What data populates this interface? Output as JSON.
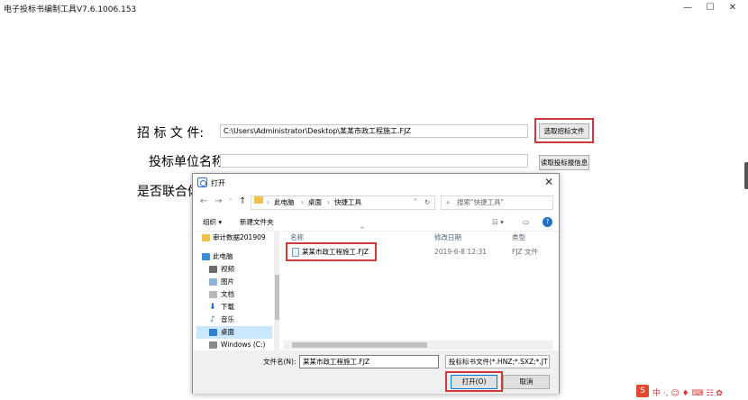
{
  "app": {
    "title": "电子投标书编制工具V7.6.1006.153",
    "minimize": "—",
    "maximize": "☐",
    "close": "✕"
  },
  "form": {
    "bid_file_label": "招  标  文  件:",
    "bid_file_value": "C:\\Users\\Administrator\\Desktop\\某某市政工程施工.FJZ",
    "select_bid_file_button": "选取招标文件",
    "bidder_name_label": "投标单位名称:",
    "bidder_name_value": "",
    "read_bidder_info_button": "读取投标报信息",
    "joint_label": "是否联合体"
  },
  "dialog": {
    "title": "打开",
    "close": "✕",
    "breadcrumb": [
      "此电脑",
      "桌面",
      "快捷工具"
    ],
    "search_placeholder": "搜索\"快捷工具\"",
    "organize": "组织 ▾",
    "new_folder": "新建文件夹",
    "nav_items": [
      {
        "label": "审计数据201909",
        "icon": "folder-icon"
      },
      {
        "label": "此电脑",
        "icon": "pc-icon"
      },
      {
        "label": "视频",
        "icon": "video-icon"
      },
      {
        "label": "图片",
        "icon": "pictures-icon"
      },
      {
        "label": "文档",
        "icon": "documents-icon"
      },
      {
        "label": "下载",
        "icon": "download-icon"
      },
      {
        "label": "音乐",
        "icon": "music-icon"
      },
      {
        "label": "桌面",
        "icon": "desktop-icon"
      },
      {
        "label": "Windows (C:)",
        "icon": "drive-icon"
      }
    ],
    "columns": {
      "name": "名称",
      "modified": "修改日期",
      "type": "类型"
    },
    "files": [
      {
        "name": "某某市政工程施工.FJZ",
        "modified": "2019-6-8 12:31",
        "type": "FJZ 文件"
      }
    ],
    "filename_label": "文件名(N):",
    "filename_value": "某某市政工程施工.FJZ",
    "filetype_value": "投标标书文件(*.HNZ;*.SXZ;*.JT",
    "open_button": "打开(O)",
    "cancel_button": "取消"
  },
  "tray": {
    "text": "中 ·, ☺ ♦ ⌨ ☷ ✿"
  },
  "colors": {
    "highlight_red": "#d23a3a",
    "selection_blue": "#cce8ff",
    "accent_blue": "#0078d7"
  }
}
